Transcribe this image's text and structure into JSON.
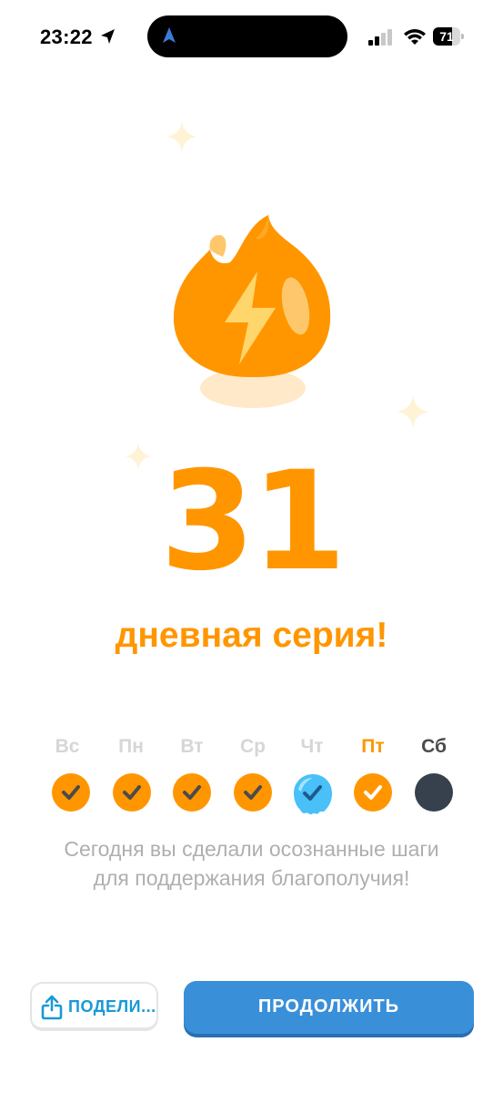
{
  "status_bar": {
    "time": "23:22",
    "battery_level": "71",
    "battery_fraction": 0.71
  },
  "streak": {
    "count": "31",
    "label": "дневная серия!",
    "accent_color": "#ff9600"
  },
  "week": {
    "days": [
      {
        "label": "Вс",
        "state": "done"
      },
      {
        "label": "Пн",
        "state": "done"
      },
      {
        "label": "Вт",
        "state": "done"
      },
      {
        "label": "Ср",
        "state": "done"
      },
      {
        "label": "Чт",
        "state": "freeze"
      },
      {
        "label": "Пт",
        "state": "today-done"
      },
      {
        "label": "Сб",
        "state": "upcoming"
      }
    ]
  },
  "message": "Сегодня вы сделали осознанные шаги для поддержания благополучия!",
  "actions": {
    "share_label": "ПОДЕЛИ...",
    "continue_label": "ПРОДОЛЖИТЬ"
  },
  "icons": {
    "flame": "flame-lightning-icon",
    "share": "share-icon",
    "sparkle": "sparkle-icon",
    "check": "checkmark-icon",
    "freeze": "streak-freeze-icon"
  }
}
